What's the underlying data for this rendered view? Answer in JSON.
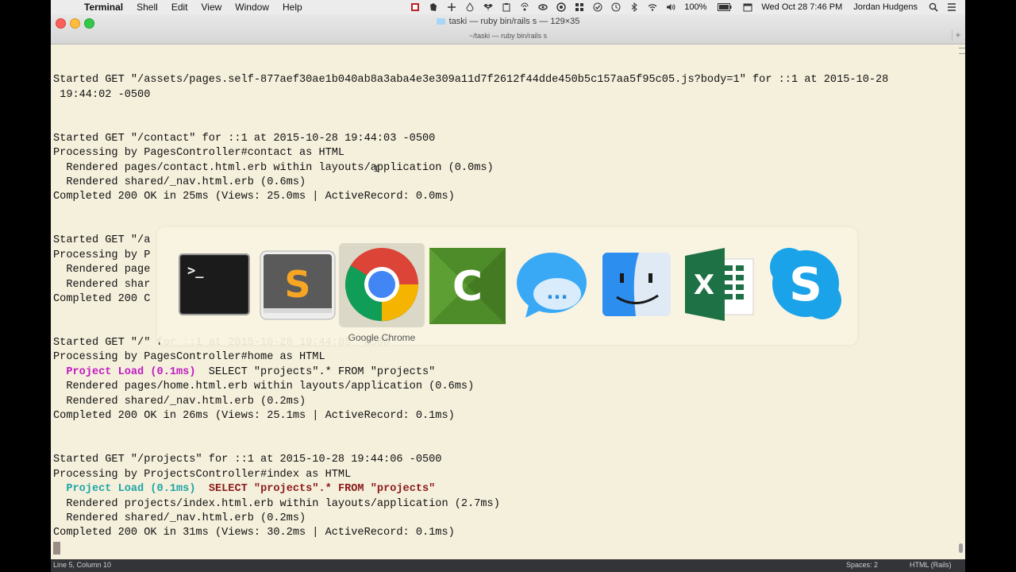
{
  "menubar": {
    "apple_glyph": "",
    "items": [
      "Terminal",
      "Shell",
      "Edit",
      "View",
      "Window",
      "Help"
    ],
    "battery": "100%",
    "datetime": "Wed Oct 28  7:46 PM",
    "user": "Jordan Hudgens"
  },
  "window": {
    "title": "taski — ruby bin/rails s — 129×35",
    "tab_title": "~/taski — ruby bin/rails s",
    "new_tab_glyph": "+"
  },
  "terminal": {
    "lines": [
      {
        "text": "Started GET \"/assets/pages.self-877aef30ae1b040ab8a3aba4e3e309a11d7f2612f44dde450b5c157aa5f95c05.js?body=1\" for ::1 at 2015-10-28"
      },
      {
        "text": " 19:44:02 -0500"
      },
      {
        "text": "Started GET \"/contact\" for ::1 at 2015-10-28 19:44:03 -0500"
      },
      {
        "text": "Processing by PagesController#contact as HTML"
      },
      {
        "text": "  Rendered pages/contact.html.erb within layouts/application (0.0ms)"
      },
      {
        "text": "  Rendered shared/_nav.html.erb (0.6ms)"
      },
      {
        "text": "Completed 200 OK in 25ms (Views: 25.0ms | ActiveRecord: 0.0ms)"
      },
      {
        "text": "Started GET \"/a"
      },
      {
        "text": "Processing by P"
      },
      {
        "text": "  Rendered page"
      },
      {
        "text": "  Rendered shar"
      },
      {
        "text": "Completed 200 C"
      },
      {
        "text": "Started GET \"/\" for ::1 at 2015-10-28 19:44:05 -0500"
      },
      {
        "text": "Processing by PagesController#home as HTML"
      },
      {
        "prefix": "  ",
        "tag": "Project Load (0.1ms)",
        "rest": "  SELECT \"projects\".* FROM \"projects\""
      },
      {
        "text": "  Rendered pages/home.html.erb within layouts/application (0.6ms)"
      },
      {
        "text": "  Rendered shared/_nav.html.erb (0.2ms)"
      },
      {
        "text": "Completed 200 OK in 26ms (Views: 25.1ms | ActiveRecord: 0.1ms)"
      },
      {
        "text": "Started GET \"/projects\" for ::1 at 2015-10-28 19:44:06 -0500"
      },
      {
        "text": "Processing by ProjectsController#index as HTML"
      },
      {
        "prefix": "  ",
        "tag": "Project Load (0.1ms)",
        "rest": "SELECT \"projects\".* FROM \"projects\""
      },
      {
        "text": "  Rendered projects/index.html.erb within layouts/application (2.7ms)"
      },
      {
        "text": "  Rendered shared/_nav.html.erb (0.2ms)"
      },
      {
        "text": "Completed 200 OK in 31ms (Views: 30.2ms | ActiveRecord: 0.1ms)"
      }
    ]
  },
  "app_switcher": {
    "apps": [
      {
        "icon": "terminal-app-icon",
        "glyph": ">_"
      },
      {
        "icon": "sublime-text-app-icon",
        "glyph": "S"
      },
      {
        "icon": "google-chrome-app-icon"
      },
      {
        "icon": "camtasia-app-icon",
        "glyph": "C"
      },
      {
        "icon": "messages-app-icon",
        "glyph": "..."
      },
      {
        "icon": "finder-app-icon"
      },
      {
        "icon": "excel-app-icon",
        "glyph": "X"
      },
      {
        "icon": "skype-app-icon",
        "glyph": "S"
      }
    ],
    "selected_label": "Google Chrome"
  },
  "statusbar": {
    "position": "Line 5, Column 10",
    "spaces": "Spaces: 2",
    "syntax": "HTML (Rails)"
  },
  "colors": {
    "terminal_bg": "#f5f0dc",
    "magenta": "#c21ac2",
    "cyan": "#1fa5a5",
    "darkred": "#8b1a1a"
  }
}
